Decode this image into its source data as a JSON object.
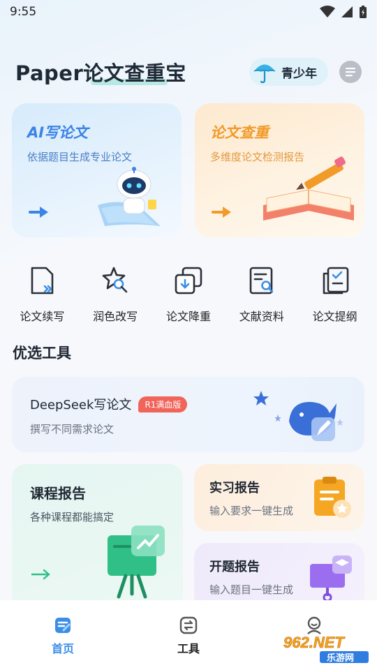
{
  "status_bar": {
    "time": "9:55"
  },
  "header": {
    "title": "Paper论文查重宝",
    "youth_label": "青少年"
  },
  "feature_cards": [
    {
      "title": "AI写论文",
      "subtitle": "依据题目生成专业论文"
    },
    {
      "title": "论文查重",
      "subtitle": "多维度论文检测报告"
    }
  ],
  "quick_tools": [
    {
      "label": "论文续写",
      "icon": "document-continue-icon"
    },
    {
      "label": "润色改写",
      "icon": "polish-star-icon"
    },
    {
      "label": "论文降重",
      "icon": "copy-reduce-icon"
    },
    {
      "label": "文献资料",
      "icon": "literature-search-icon"
    },
    {
      "label": "论文提纲",
      "icon": "outline-checklist-icon"
    }
  ],
  "section": {
    "title": "优选工具"
  },
  "deepseek_card": {
    "title": "DeepSeek写论文",
    "badge": "R1满血版",
    "subtitle": "撰写不同需求论文"
  },
  "course_card": {
    "title": "课程报告",
    "subtitle": "各种课程都能搞定"
  },
  "intern_card": {
    "title": "实习报告",
    "subtitle": "输入要求一键生成"
  },
  "proposal_card": {
    "title": "开题报告",
    "subtitle": "输入题目一键生成"
  },
  "bottom_nav": [
    {
      "label": "首页",
      "icon": "home-doc-icon",
      "active": true
    },
    {
      "label": "工具",
      "icon": "tools-icon",
      "active": false
    },
    {
      "label": "",
      "icon": "profile-icon",
      "active": false
    }
  ],
  "watermark": {
    "brand_top": "962.NET",
    "brand_bottom": "乐游网"
  },
  "colors": {
    "accent_blue": "#3b83e6",
    "accent_orange": "#f29a2a",
    "badge_red": "#f0645a",
    "course_green": "#2fbf87"
  }
}
